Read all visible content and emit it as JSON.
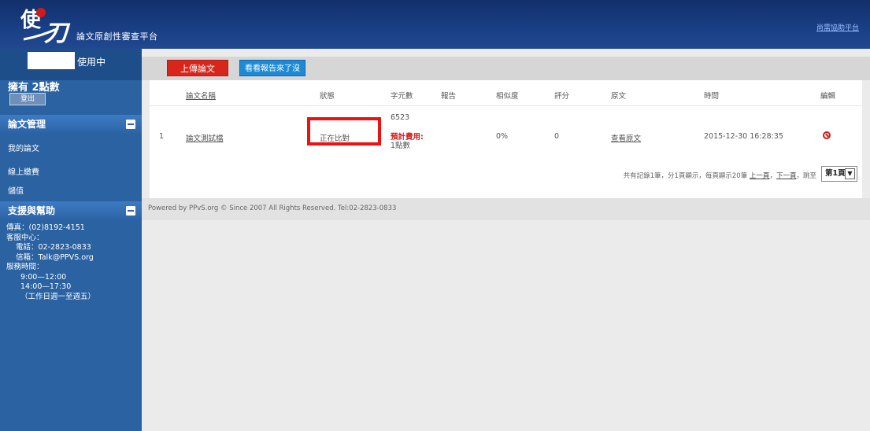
{
  "header": {
    "platform_name": "論文原創性審查平台",
    "help_link": "尚需協助平台"
  },
  "sidebar": {
    "user_status": "使用中",
    "points": "擁有 2點數",
    "logout": "登出",
    "section_paper": "論文管理",
    "items": [
      "我的論文",
      "線上繳費",
      "儲值"
    ],
    "section_support": "支援與幫助",
    "contact": {
      "fax": "傳真：(02)8192-4151",
      "service_center": "客服中心：",
      "phone": "電話：02-2823-0833",
      "email": "信箱：Talk@PPVS.org",
      "hours_title": "服務時間：",
      "hours_1": "9:00—12:00",
      "hours_2": "14:00—17:30",
      "days": "（工作日週一至週五）"
    }
  },
  "toolbar": {
    "upload": "上傳論文",
    "report": "看看報告來了沒"
  },
  "table": {
    "headers": {
      "name": "論文名稱",
      "status": "狀態",
      "chars": "字元數",
      "report": "報告",
      "similarity": "相似度",
      "score": "評分",
      "original": "原文",
      "time": "時間",
      "edit": "編輯"
    },
    "rows": [
      {
        "index": "1",
        "name": "論文測試檔",
        "status": "正在比對",
        "chars": "6523",
        "cost_label": "預計費用:",
        "cost_value": "1點數",
        "similarity": "0%",
        "score": "0",
        "original": "查看原文",
        "time": "2015-12-30 16:28:35"
      }
    ]
  },
  "pager": {
    "summary": "共有記錄1筆，分1頁顯示，每頁顯示20筆",
    "prev": "上一頁",
    "next": "下一頁",
    "jump": "跳至",
    "page": "第1頁"
  },
  "footer": "Powered by PPvS.org © Since 2007 All Rights Reserved. Tel:02-2823-0833"
}
